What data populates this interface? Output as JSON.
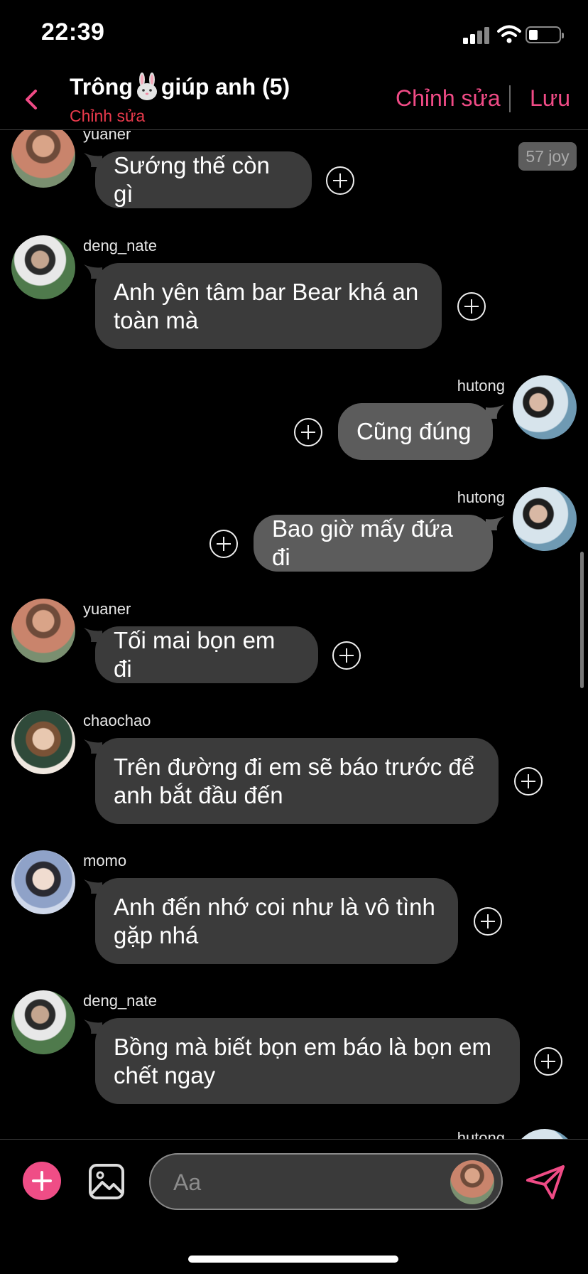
{
  "status_bar": {
    "time": "22:39"
  },
  "header": {
    "title_before": "Trông",
    "title_after": "giúp anh (5)",
    "title_icon": "rabbit-emoji",
    "subtitle": "Chỉnh sửa",
    "edit_label": "Chỉnh sửa",
    "save_label": "Lưu",
    "accent": "#f04b86"
  },
  "badge": {
    "joy": "57 joy"
  },
  "messages": [
    {
      "user": "yuaner",
      "text": "Sướng thế còn gì",
      "side": "in"
    },
    {
      "user": "deng_nate",
      "text": "Anh yên tâm bar Bear khá an toàn mà",
      "side": "in"
    },
    {
      "user": "hutong",
      "text": "Cũng đúng",
      "side": "out"
    },
    {
      "user": "hutong",
      "text": "Bao giờ mấy đứa đi",
      "side": "out"
    },
    {
      "user": "yuaner",
      "text": "Tối mai bọn em đi",
      "side": "in"
    },
    {
      "user": "chaochao",
      "text": "Trên đường đi em sẽ báo trước để anh bắt đầu đến",
      "side": "in"
    },
    {
      "user": "momo",
      "text": "Anh đến nhớ coi như là vô tình gặp nhá",
      "side": "in"
    },
    {
      "user": "deng_nate",
      "text": "Bồng mà biết bọn em báo là bọn em chết ngay",
      "side": "in"
    },
    {
      "user": "hutong",
      "text": "",
      "side": "out"
    }
  ],
  "composer": {
    "placeholder": "Aa"
  },
  "colors": {
    "bubble_in": "#3b3b3b",
    "bubble_out": "#5c5c5c",
    "background": "#000000"
  }
}
